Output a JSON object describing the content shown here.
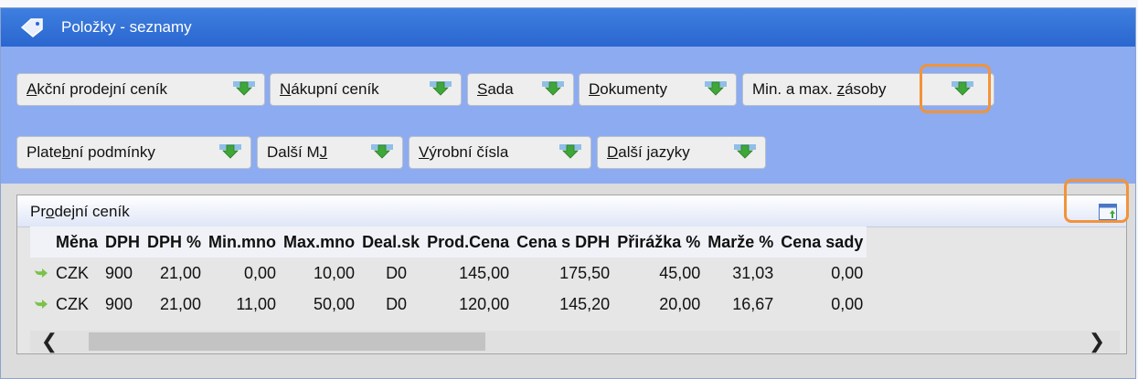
{
  "window": {
    "title": "Položky - seznamy"
  },
  "toolbar": {
    "row1": [
      {
        "pre": "",
        "u": "A",
        "post": "kční prodejní ceník"
      },
      {
        "pre": "",
        "u": "N",
        "post": "ákupní ceník"
      },
      {
        "pre": "",
        "u": "S",
        "post": "ada"
      },
      {
        "pre": "",
        "u": "D",
        "post": "okumenty"
      },
      {
        "pre": "Min. a max. ",
        "u": "z",
        "post": "ásoby"
      }
    ],
    "row2": [
      {
        "pre": "Plate",
        "u": "b",
        "post": "ní podmínky"
      },
      {
        "pre": "Další M",
        "u": "J",
        "post": ""
      },
      {
        "pre": "",
        "u": "V",
        "post": "ýrobní čísla"
      },
      {
        "pre": "",
        "u": "D",
        "post": "alší jazyky"
      }
    ]
  },
  "panel": {
    "title_pre": "Pr",
    "title_u": "o",
    "title_post": "dejní ceník"
  },
  "table": {
    "headers": [
      "Měna",
      "DPH",
      "DPH %",
      "Min.mno",
      "Max.mno",
      "Deal.sk",
      "Prod.Cena",
      "Cena s DPH",
      "Přirážka %",
      "Marže %",
      "Cena sady"
    ],
    "rows": [
      [
        "CZK",
        "900",
        "21,00",
        "0,00",
        "10,00",
        "D0",
        "145,00",
        "175,50",
        "45,00",
        "31,03",
        "0,00"
      ],
      [
        "CZK",
        "900",
        "21,00",
        "11,00",
        "50,00",
        "D0",
        "120,00",
        "145,20",
        "20,00",
        "16,67",
        "0,00"
      ]
    ]
  },
  "scrollbar": {
    "left_arrow": "❮",
    "right_arrow": "❯"
  },
  "colors": {
    "accent": "#f2933a",
    "titlebar": "#2f6fdb",
    "toolbar": "#8cabf0"
  }
}
